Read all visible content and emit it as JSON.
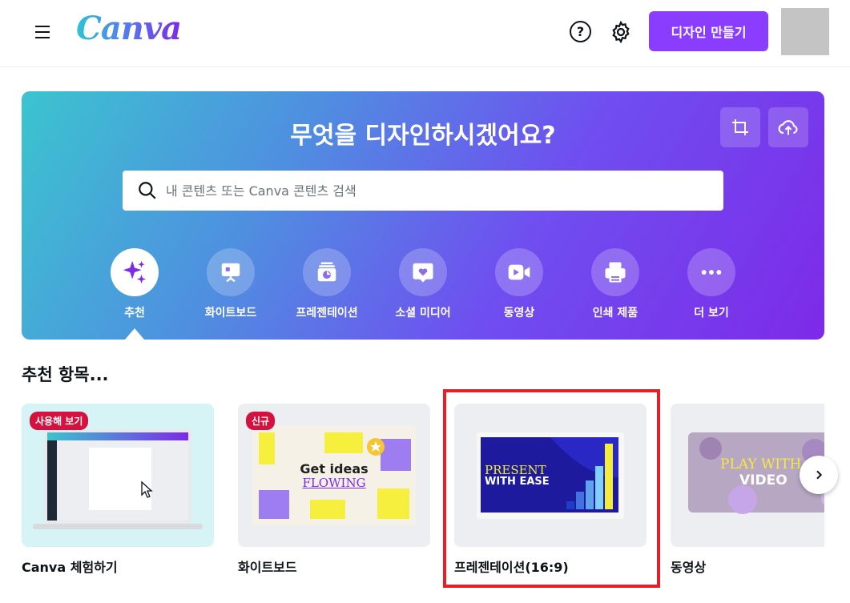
{
  "header": {
    "logo": "Canva",
    "help_icon": "?",
    "create_button": "디자인 만들기"
  },
  "hero": {
    "title": "무엇을 디자인하시겠어요?",
    "search_placeholder": "내 콘텐츠 또는 Canva 콘텐츠 검색",
    "categories": [
      {
        "label": "추천",
        "icon": "sparkle-icon"
      },
      {
        "label": "화이트보드",
        "icon": "whiteboard-icon"
      },
      {
        "label": "프레젠테이션",
        "icon": "presentation-icon"
      },
      {
        "label": "소셜 미디어",
        "icon": "heart-icon"
      },
      {
        "label": "동영상",
        "icon": "video-icon"
      },
      {
        "label": "인쇄 제품",
        "icon": "printer-icon"
      },
      {
        "label": "더 보기",
        "icon": "more-icon"
      }
    ]
  },
  "recommended": {
    "title": "추천 항목...",
    "cards": [
      {
        "label": "Canva 체험하기",
        "badge": "사용해 보기"
      },
      {
        "label": "화이트보드",
        "badge": "신규",
        "thumb_text_1": "Get ideas",
        "thumb_text_2": "FLOWING"
      },
      {
        "label": "프레젠테이션(16:9)",
        "thumb_text_1": "PRESENT",
        "thumb_text_2": "WITH EASE"
      },
      {
        "label": "동영상",
        "thumb_text_1": "PLAY WITH",
        "thumb_text_2": "VIDEO"
      }
    ]
  },
  "colors": {
    "brand_purple": "#8b3dff",
    "badge_red": "#d4113f",
    "highlight_red": "#e81d25"
  }
}
